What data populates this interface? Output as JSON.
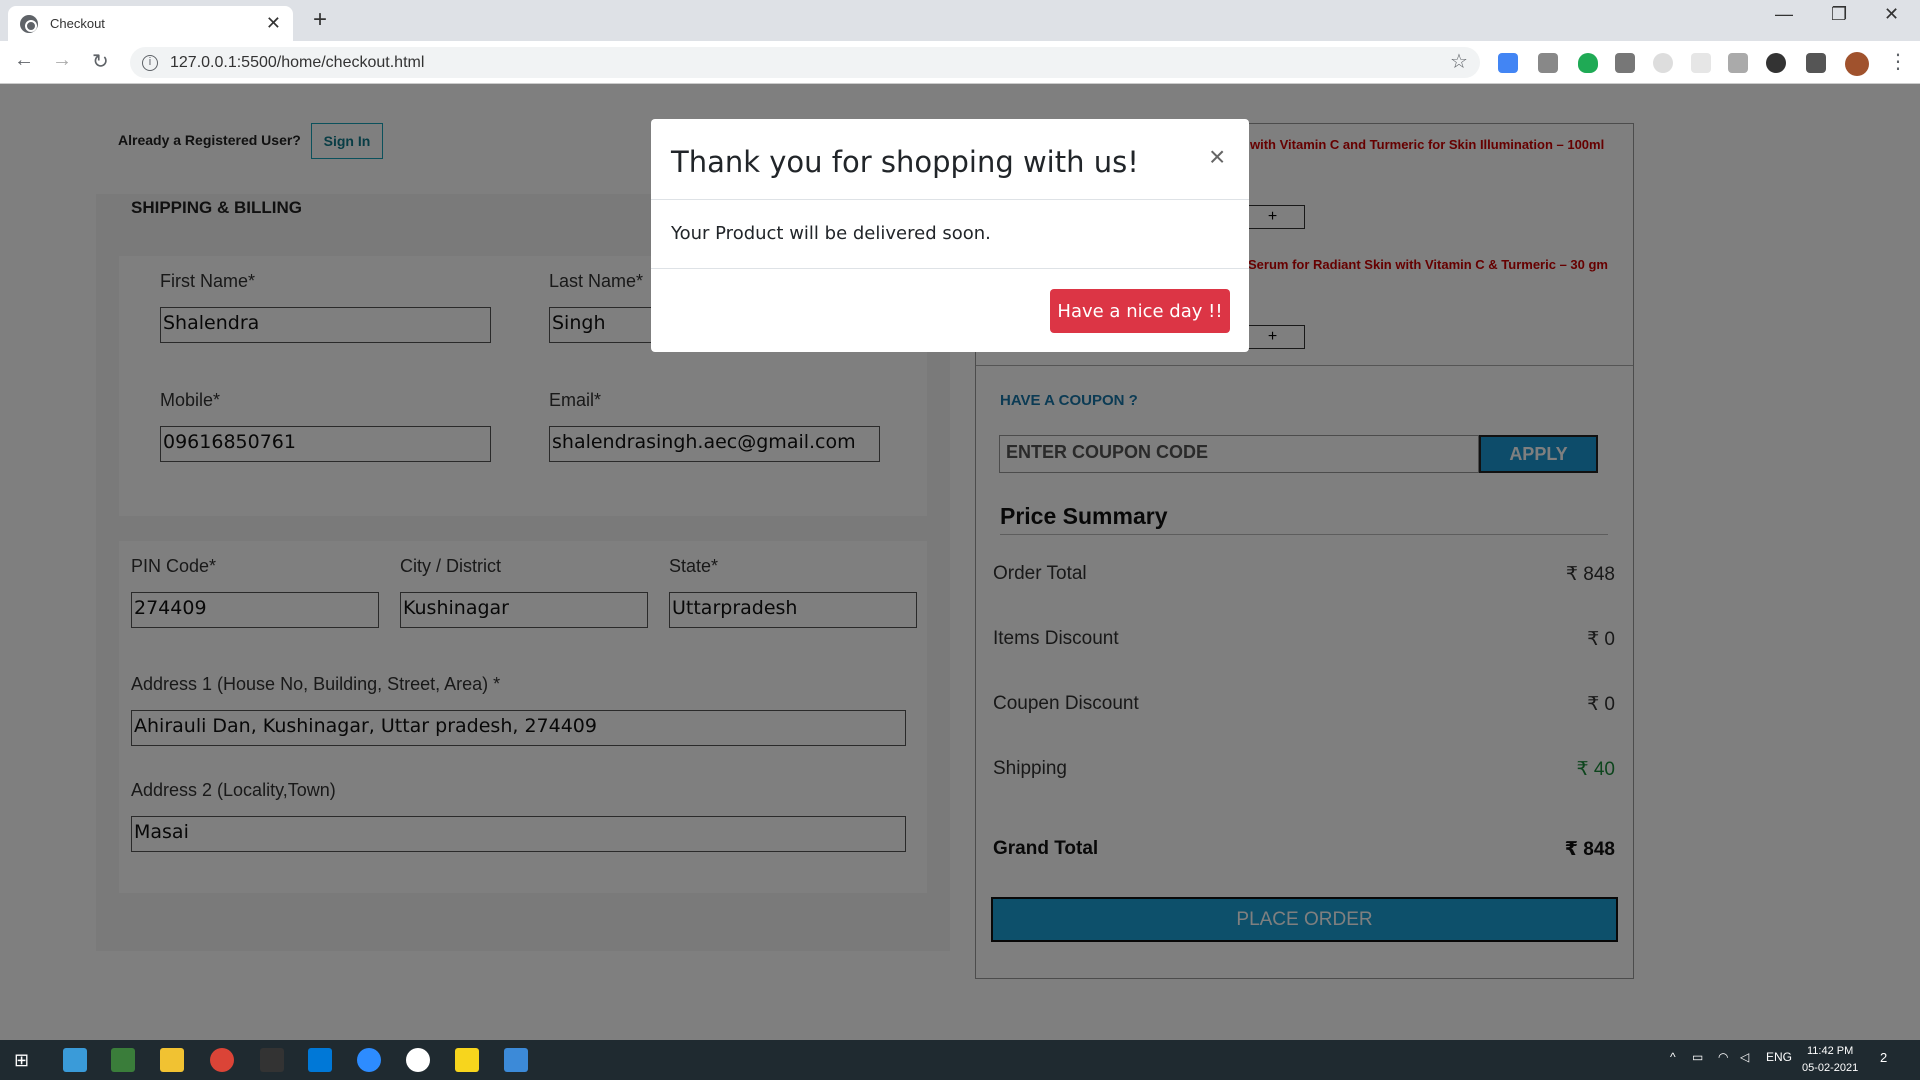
{
  "browser": {
    "tab_title": "Checkout",
    "url": "127.0.0.1:5500/home/checkout.html"
  },
  "header": {
    "registered_text": "Already a Registered User?",
    "signin_label": "Sign In"
  },
  "form": {
    "section_title": "SHIPPING & BILLING",
    "first_name_label": "First Name*",
    "first_name_value": "Shalendra",
    "last_name_label": "Last Name*",
    "last_name_value": "Singh",
    "mobile_label": "Mobile*",
    "mobile_value": "09616850761",
    "email_label": "Email*",
    "email_value": "shalendrasingh.aec@gmail.com",
    "pin_label": "PIN Code*",
    "pin_value": "274409",
    "city_label": "City / District",
    "city_value": "Kushinagar",
    "state_label": "State*",
    "state_value": "Uttarpradesh",
    "address1_label": "Address 1 (House No, Building, Street, Area) *",
    "address1_value": "Ahirauli Dan, Kushinagar, Uttar pradesh, 274409",
    "address2_label": "Address 2 (Locality,Town)",
    "address2_value": "Masai"
  },
  "cart": {
    "product1": "with Vitamin C and Turmeric for Skin Illumination – 100ml",
    "product2": "Serum for Radiant Skin with Vitamin C & Turmeric – 30 gm",
    "plus": "+"
  },
  "coupon": {
    "heading": "HAVE A COUPON ?",
    "placeholder": "ENTER COUPON CODE",
    "apply_label": "APPLY"
  },
  "summary": {
    "title": "Price Summary",
    "order_total_label": "Order Total",
    "order_total_value": "₹ 848",
    "items_discount_label": "Items Discount",
    "items_discount_value": "₹ 0",
    "coupon_discount_label": "Coupen Discount",
    "coupon_discount_value": "₹ 0",
    "shipping_label": "Shipping",
    "shipping_value": "₹ 40",
    "grand_total_label": "Grand Total",
    "grand_total_value": "₹ 848",
    "place_order_label": "PLACE ORDER"
  },
  "modal": {
    "title": "Thank you for shopping with us!",
    "close": "×",
    "body": "Your Product will be delivered soon.",
    "button_label": "Have a nice day !!"
  },
  "taskbar": {
    "lang": "ENG",
    "time": "11:42 PM",
    "date": "05-02-2021",
    "notifications": "2"
  },
  "colors": {
    "accent": "#1a98d5",
    "danger": "#dc3545",
    "product_text": "#cc0000",
    "shipping_value": "#1a8a3a"
  }
}
